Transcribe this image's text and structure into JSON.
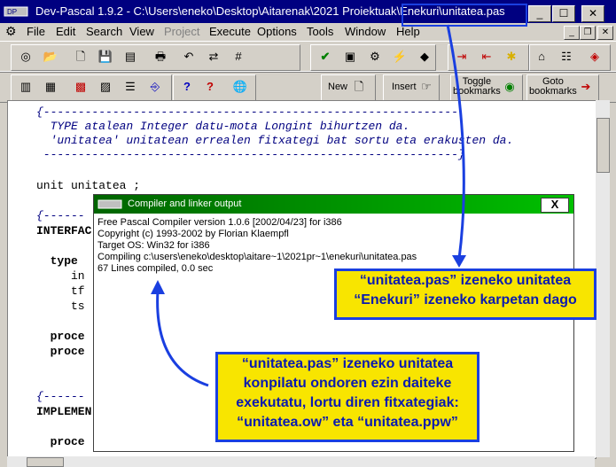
{
  "window": {
    "title": "Dev-Pascal 1.9.2 - C:\\Users\\eneko\\Desktop\\Aitarenak\\2021 Proiektuak\\Enekuri\\unitatea.pas",
    "min": "_",
    "max": "☐",
    "close": "✕"
  },
  "menu": [
    "File",
    "Edit",
    "Search",
    "View",
    "Project",
    "Execute",
    "Options",
    "Tools",
    "Window",
    "Help"
  ],
  "toolbar": {
    "new_label": "New",
    "insert_label": "Insert",
    "toggle_bookmarks_label": "Toggle\nbookmarks",
    "goto_bookmarks_label": "Goto\nbookmarks"
  },
  "editor": {
    "lines": [
      "{------------------------------------------------------------",
      "  TYPE atalean Integer datu-mota Longint bihurtzen da.",
      "  'unitatea' unitatean errealen fitxategi bat sortu eta erakusten da.",
      " ------------------------------------------------------------}",
      "",
      "unit unitatea ;",
      "",
      "{------",
      "INTERFAC",
      "",
      "  type",
      "     in",
      "     tf",
      "     ts",
      "",
      "  proce",
      "  proce",
      "",
      "",
      "{------",
      "IMPLEMEN",
      "",
      "  proce"
    ]
  },
  "compiler_window": {
    "title": "Compiler and linker output",
    "close": "X",
    "output": [
      "Free Pascal Compiler version 1.0.6 [2002/04/23] for i386",
      "Copyright (c) 1993-2002 by Florian Klaempfl",
      "Target OS: Win32 for i386",
      "Compiling c:\\users\\eneko\\desktop\\aitare~1\\2021pr~1\\enekuri\\unitatea.pas",
      "67 Lines compiled, 0.0 sec"
    ]
  },
  "callouts": {
    "folder": [
      "“unitatea.pas” izeneko unitatea",
      "“Enekuri” izeneko karpetan dago"
    ],
    "compiled": [
      "“unitatea.pas” izeneko unitatea",
      "konpilatu ondoren ezin daiteke",
      "exekutatu, lortu diren fitxategiak:",
      "“unitatea.ow” eta “unitatea.ppw”"
    ]
  },
  "colors": {
    "titlebar": "#000080",
    "callout_fill": "#f8e500",
    "callout_border": "#1a3fe0",
    "compiler_title": "#008000"
  }
}
